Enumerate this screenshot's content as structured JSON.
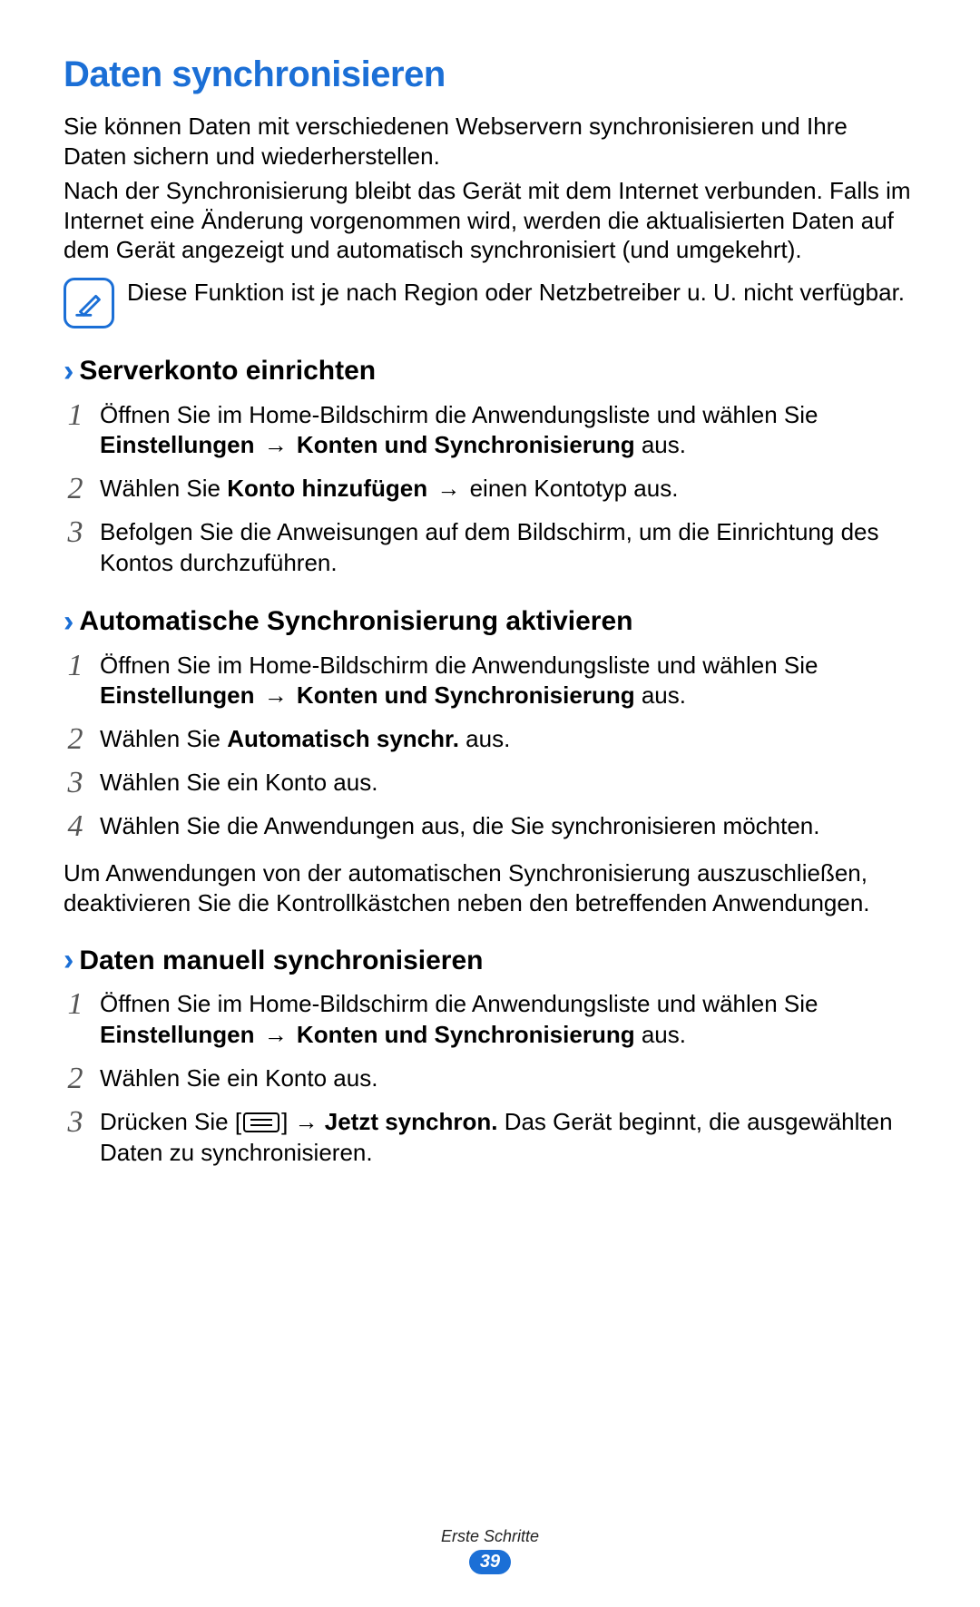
{
  "title": "Daten synchronisieren",
  "intro1": "Sie können Daten mit verschiedenen Webservern synchronisieren und Ihre Daten sichern und wiederherstellen.",
  "intro2": "Nach der Synchronisierung bleibt das Gerät mit dem Internet verbunden. Falls im Internet eine Änderung vorgenommen wird, werden die aktualisierten Daten auf dem Gerät angezeigt und automatisch synchronisiert (und umgekehrt).",
  "note": "Diese Funktion ist je nach Region oder Netzbetreiber u. U. nicht verfügbar.",
  "sections": [
    {
      "heading": "Serverkonto einrichten",
      "steps": [
        {
          "num": "1",
          "pre": "Öffnen Sie im Home-Bildschirm die Anwendungsliste und wählen Sie ",
          "b1": "Einstellungen",
          "arrow1": " → ",
          "b2": "Konten und Synchronisierung",
          "post": " aus."
        },
        {
          "num": "2",
          "pre": "Wählen Sie ",
          "b1": "Konto hinzufügen",
          "arrow1": " → ",
          "post": "einen Kontotyp aus."
        },
        {
          "num": "3",
          "plain": "Befolgen Sie die Anweisungen auf dem Bildschirm, um die Einrichtung des Kontos durchzuführen."
        }
      ]
    },
    {
      "heading": "Automatische Synchronisierung aktivieren",
      "steps": [
        {
          "num": "1",
          "pre": "Öffnen Sie im Home-Bildschirm die Anwendungsliste und wählen Sie ",
          "b1": "Einstellungen",
          "arrow1": " → ",
          "b2": "Konten und Synchronisierung",
          "post": " aus."
        },
        {
          "num": "2",
          "pre": "Wählen Sie ",
          "b1": "Automatisch synchr.",
          "post": " aus."
        },
        {
          "num": "3",
          "plain": "Wählen Sie ein Konto aus."
        },
        {
          "num": "4",
          "plain": "Wählen Sie die Anwendungen aus, die Sie synchronisieren möchten."
        }
      ],
      "after": "Um Anwendungen von der automatischen Synchronisierung auszuschließen, deaktivieren Sie die Kontrollkästchen neben den betreffenden Anwendungen."
    },
    {
      "heading": "Daten manuell synchronisieren",
      "steps": [
        {
          "num": "1",
          "pre": "Öffnen Sie im Home-Bildschirm die Anwendungsliste und wählen Sie ",
          "b1": "Einstellungen",
          "arrow1": " → ",
          "b2": "Konten und Synchronisierung",
          "post": " aus."
        },
        {
          "num": "2",
          "plain": "Wählen Sie ein Konto aus."
        },
        {
          "num": "3",
          "pre": "Drücken Sie [",
          "menuicon": true,
          "mid": "] → ",
          "b1": "Jetzt synchron.",
          "post": " Das Gerät beginnt, die ausgewählten Daten zu synchronisieren."
        }
      ]
    }
  ],
  "footer": {
    "chapter": "Erste Schritte",
    "page": "39"
  }
}
